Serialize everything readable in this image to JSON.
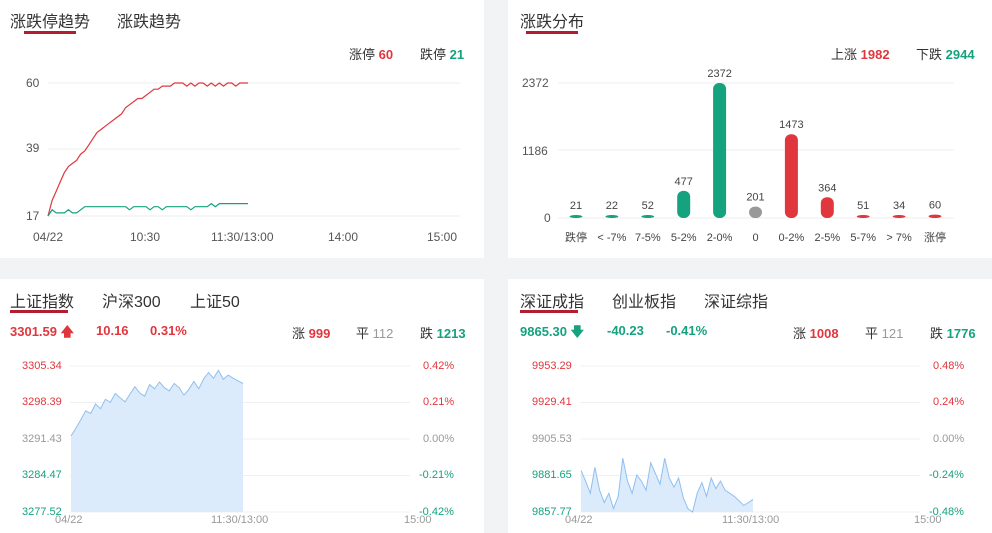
{
  "zdt": {
    "tabs": [
      "涨跌停趋势",
      "涨跌趋势"
    ],
    "limit_up_label": "涨停",
    "limit_up": "60",
    "limit_down_label": "跌停",
    "limit_down": "21",
    "y_ticks": [
      "60",
      "39",
      "17"
    ],
    "x_ticks": [
      "04/22",
      "10:30",
      "11:30/13:00",
      "14:00",
      "15:00"
    ]
  },
  "dist": {
    "tab": "涨跌分布",
    "up_label": "上涨",
    "up": "1982",
    "down_label": "下跌",
    "down": "2944",
    "y_ticks": [
      "2372",
      "1186",
      "0"
    ]
  },
  "sh": {
    "tabs": [
      "上证指数",
      "沪深300",
      "上证50"
    ],
    "price": "3301.59",
    "change": "10.16",
    "pct": "0.31%",
    "up_label": "涨",
    "up": "999",
    "flat_label": "平",
    "flat": "112",
    "down_label": "跌",
    "down": "1213",
    "left_ticks": [
      "3305.34",
      "3298.39",
      "3291.43",
      "3284.47",
      "3277.52"
    ],
    "right_ticks": [
      "0.42%",
      "0.21%",
      "0.00%",
      "-0.21%",
      "-0.42%"
    ],
    "x_ticks": [
      "04/22",
      "11:30/13:00",
      "15:00"
    ]
  },
  "sz": {
    "tabs": [
      "深证成指",
      "创业板指",
      "深证综指"
    ],
    "price": "9865.30",
    "change": "-40.23",
    "pct": "-0.41%",
    "up_label": "涨",
    "up": "1008",
    "flat_label": "平",
    "flat": "121",
    "down_label": "跌",
    "down": "1776",
    "left_ticks": [
      "9953.29",
      "9929.41",
      "9905.53",
      "9881.65",
      "9857.77"
    ],
    "right_ticks": [
      "0.48%",
      "0.24%",
      "0.00%",
      "-0.24%",
      "-0.48%"
    ],
    "x_ticks": [
      "04/22",
      "11:30/13:00",
      "15:00"
    ]
  },
  "colors": {
    "red": "#e0363d",
    "green": "#14a27f",
    "gray": "#999999",
    "accent": "#b01e2f",
    "area": "#dcebfc",
    "area_line": "#8fbfef"
  },
  "chart_data": [
    {
      "type": "line",
      "series": [
        {
          "name": "涨停",
          "values": [
            17,
            22,
            25,
            28,
            31,
            33,
            34,
            35,
            37,
            38,
            40,
            42,
            44,
            45,
            46,
            47,
            48,
            49,
            50,
            52,
            53,
            54,
            55,
            55,
            56,
            57,
            58,
            58,
            59,
            59,
            59,
            60,
            60,
            60,
            59,
            60,
            59,
            60,
            60,
            59,
            60,
            59,
            60,
            59,
            60,
            60,
            59,
            60,
            60,
            60
          ]
        },
        {
          "name": "跌停",
          "values": [
            17,
            19,
            18,
            18,
            18,
            19,
            18,
            18,
            19,
            20,
            20,
            20,
            20,
            20,
            20,
            20,
            20,
            20,
            20,
            20,
            19,
            20,
            20,
            20,
            20,
            19,
            20,
            20,
            19,
            20,
            20,
            20,
            20,
            20,
            20,
            19,
            20,
            20,
            20,
            20,
            21,
            20,
            21,
            21,
            21,
            21,
            21,
            21,
            21,
            21
          ]
        }
      ],
      "ylim": [
        17,
        60
      ],
      "x_ticks": [
        "04/22",
        "10:30",
        "11:30/13:00",
        "14:00",
        "15:00"
      ]
    },
    {
      "type": "bar",
      "categories": [
        "跌停",
        "< -7%",
        "7-5%",
        "5-2%",
        "2-0%",
        "0",
        "0-2%",
        "2-5%",
        "5-7%",
        "> 7%",
        "涨停"
      ],
      "values": [
        21,
        22,
        52,
        477,
        2372,
        201,
        1473,
        364,
        51,
        34,
        60
      ],
      "ylim": [
        0,
        2372
      ]
    },
    {
      "type": "area",
      "ylim": [
        3277.52,
        3305.34
      ],
      "values": [
        3292.0,
        3293.5,
        3295.1,
        3296.8,
        3296.3,
        3298.1,
        3297.2,
        3299.0,
        3298.4,
        3300.1,
        3299.3,
        3298.5,
        3300.0,
        3301.4,
        3300.2,
        3299.6,
        3301.8,
        3301.0,
        3302.3,
        3301.2,
        3300.6,
        3302.0,
        3301.2,
        3299.8,
        3300.9,
        3302.4,
        3301.0,
        3302.9,
        3304.1,
        3303.0,
        3304.5,
        3302.8,
        3303.6,
        3303.0,
        3302.5,
        3302.0
      ]
    },
    {
      "type": "area",
      "ylim": [
        9857.77,
        9953.29
      ],
      "values": [
        9885,
        9878,
        9870,
        9887,
        9872,
        9864,
        9870,
        9860,
        9868,
        9893,
        9878,
        9870,
        9882,
        9878,
        9872,
        9890,
        9883,
        9876,
        9893,
        9880,
        9874,
        9880,
        9867,
        9860,
        9857.77,
        9870,
        9877,
        9868,
        9880,
        9873,
        9878,
        9872,
        9870,
        9868,
        9865,
        9862,
        9864,
        9866
      ]
    }
  ]
}
